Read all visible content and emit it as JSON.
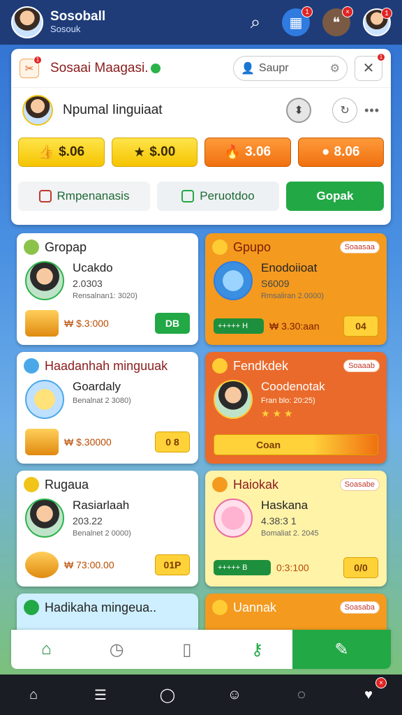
{
  "app": {
    "title": "Sosoball",
    "subtitle": "Sosouk"
  },
  "topbar": {
    "icons": [
      {
        "name": "search-icon",
        "glyph": "⌕",
        "badge": ""
      },
      {
        "name": "calendar-icon",
        "glyph": "▦",
        "badge": "1"
      },
      {
        "name": "chat-icon",
        "glyph": "❝",
        "badge": "×"
      },
      {
        "name": "profile-avatar",
        "glyph": "",
        "badge": "1"
      }
    ]
  },
  "header": {
    "title": "Sosaai Maagasi.",
    "search_placeholder": "Saupr",
    "user_name": "Npumal Iinguiaat"
  },
  "coins": [
    "$.06",
    "$.00",
    "3.06",
    "8.06"
  ],
  "actions": [
    "Rmpenanasis",
    "Peruotdoo",
    "Gopak"
  ],
  "cards": [
    {
      "title": "Gropap",
      "name": "Ucakdo",
      "value": "2.0303",
      "sub": "Rensalnan1: 3020)",
      "price": "₩ $.3:000",
      "button": "DB",
      "tag": ""
    },
    {
      "title": "Gpupo",
      "name": "Enodoiioat",
      "value": "S6009",
      "sub": "Rmsaliran 2.0000)",
      "price": "₩ 3.30:aan",
      "button": "04",
      "tag": "Soaasaa",
      "bar": "+++++ H"
    },
    {
      "title": "Haadanhah minguuak",
      "name": "Goardaly",
      "value": "",
      "sub": "Benalnat 2 3080)",
      "price": "₩ $.30000",
      "button": "0 8",
      "tag": ""
    },
    {
      "title": "Fendkdek",
      "name": "Coodenotak",
      "value": "",
      "sub": "Fran blo: 20:25)",
      "price": "",
      "button": "Coan",
      "tag": "Soaaab",
      "stars": "★ ★ ★"
    },
    {
      "title": "Rugaua",
      "name": "Rasiarlaah",
      "value": "203.22",
      "sub": "Benalnet 2 0000)",
      "price": "₩ 73:00.00",
      "button": "01P",
      "tag": ""
    },
    {
      "title": "Haiokak",
      "name": "Haskana",
      "value": "4.38:3 1",
      "sub": "Bomaliat 2. 2045",
      "price": "0:3:100",
      "button": "0/0",
      "tag": "Soasabe",
      "bar": "+++++ B"
    },
    {
      "title": "Hadikaha mingeua..",
      "name": "",
      "value": "",
      "sub": "",
      "price": "",
      "button": "",
      "tag": ""
    },
    {
      "title": "Uannak",
      "name": "",
      "value": "",
      "sub": "",
      "price": "",
      "button": "",
      "tag": "Soasaba"
    }
  ],
  "colors": {
    "green": "#22a845",
    "orange": "#f49a1f",
    "red": "#ea6a2c",
    "yellow": "#ffd23a",
    "topbar": "#1f3c78"
  }
}
